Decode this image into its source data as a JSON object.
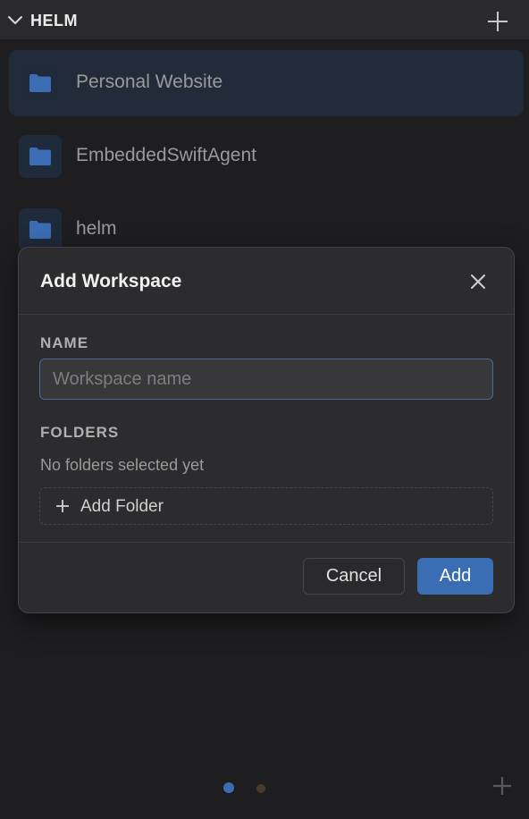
{
  "header": {
    "title": "HELM",
    "collapse_icon": "chevron-down-icon",
    "add_icon": "plus-icon"
  },
  "workspaces": [
    {
      "label": "Personal Website",
      "icon": "folder-icon",
      "selected": true
    },
    {
      "label": "EmbeddedSwiftAgent",
      "icon": "folder-icon",
      "selected": false
    },
    {
      "label": "helm",
      "icon": "folder-icon",
      "selected": false
    }
  ],
  "modal": {
    "title": "Add Workspace",
    "close_icon": "close-icon",
    "name_label": "NAME",
    "name_placeholder": "Workspace name",
    "name_value": "",
    "folders_label": "FOLDERS",
    "folders_empty": "No folders selected yet",
    "add_folder_label": "Add Folder",
    "cancel_label": "Cancel",
    "add_label": "Add"
  },
  "pager": {
    "active_index": 0,
    "count": 2,
    "colors": {
      "active": "#3a6db3",
      "inactive": "#4a3a2a"
    }
  },
  "colors": {
    "accent": "#3a6db3",
    "folder": "#3a6db3",
    "background": "#1e1e20"
  }
}
